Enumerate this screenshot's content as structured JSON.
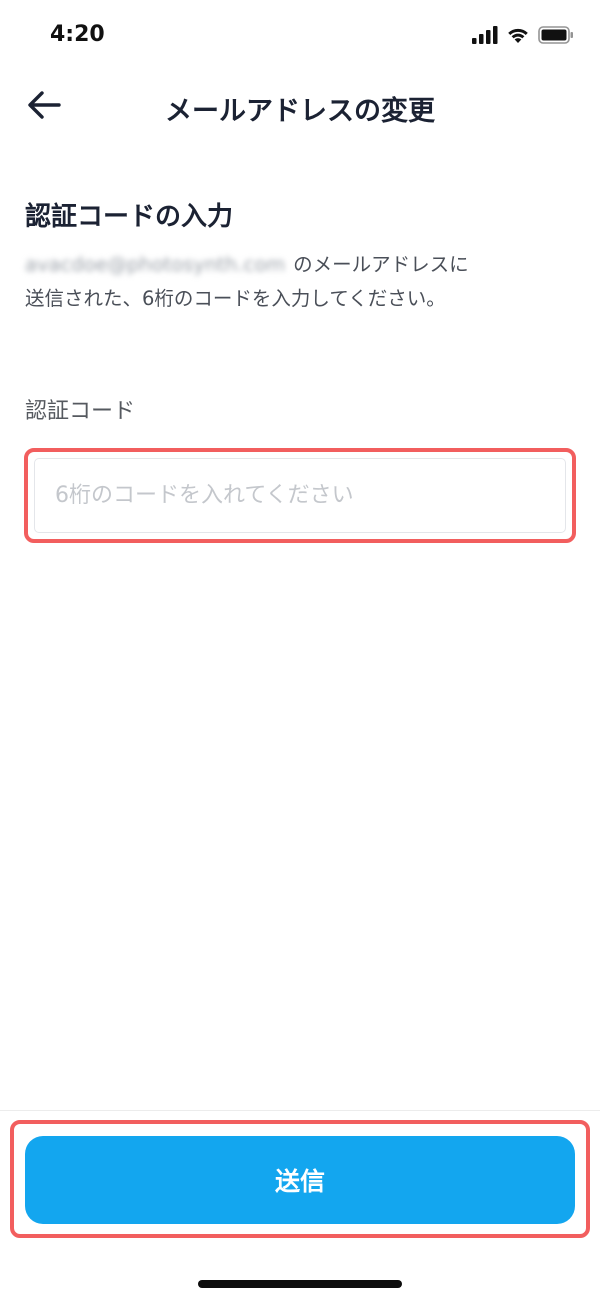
{
  "status_bar": {
    "time": "4:20",
    "icons": [
      "signal-icon",
      "wifi-icon",
      "battery-icon"
    ]
  },
  "nav": {
    "title": "メールアドレスの変更",
    "back_icon": "arrow-left-icon"
  },
  "section": {
    "title": "認証コードの入力",
    "email": "avacdoe@photosynth.com",
    "description_line1_suffix": "のメールアドレスに",
    "description_line2": "送信された、6桁のコードを入力してください。"
  },
  "field": {
    "label": "認証コード",
    "value": "",
    "placeholder": "6桁のコードを入れてください"
  },
  "submit": {
    "label": "送信"
  },
  "colors": {
    "accent": "#13a6ef",
    "highlight": "#f25e5e",
    "title_text": "#1b2233"
  }
}
